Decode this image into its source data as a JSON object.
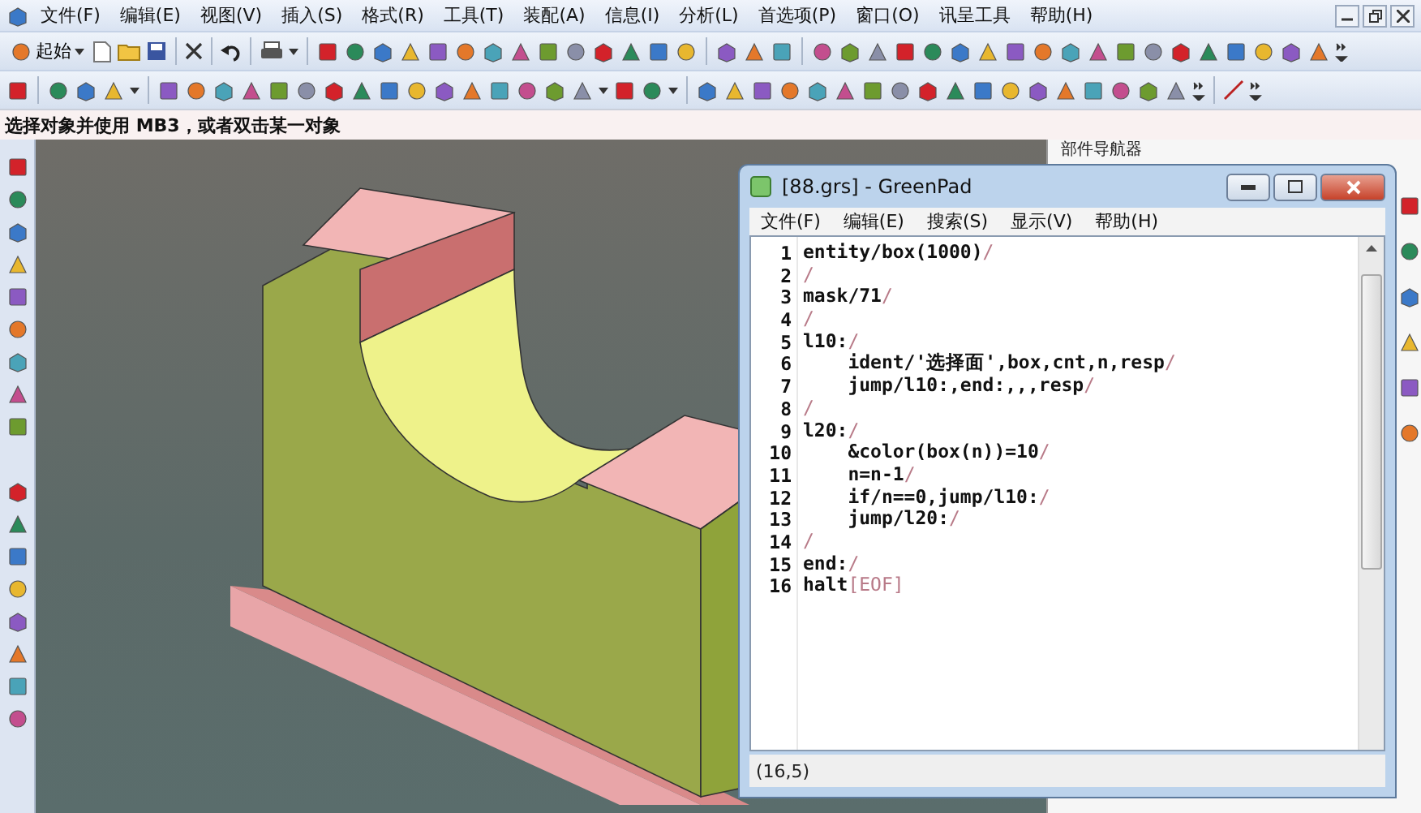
{
  "app_menu": [
    "文件(F)",
    "编辑(E)",
    "视图(V)",
    "插入(S)",
    "格式(R)",
    "工具(T)",
    "装配(A)",
    "信息(I)",
    "分析(L)",
    "首选项(P)",
    "窗口(O)",
    "讯呈工具",
    "帮助(H)"
  ],
  "start_button": {
    "label": "起始"
  },
  "hint": "选择对象并使用 MB3，或者双击某一对象",
  "navigator": {
    "title": "部件导航器"
  },
  "editor": {
    "title": "[88.grs] - GreenPad",
    "menu": [
      "文件(F)",
      "编辑(E)",
      "搜索(S)",
      "显示(V)",
      "帮助(H)"
    ],
    "eol_mark": "/",
    "eof_mark": "[EOF]",
    "lines": [
      {
        "number": "1",
        "text": "entity/box(1000)"
      },
      {
        "number": "2"
      },
      {
        "number": "3",
        "text": "mask/71"
      },
      {
        "number": "4"
      },
      {
        "number": "5",
        "text": "l10:"
      },
      {
        "number": "6",
        "text": "    ident/'选择面',box,cnt,n,resp"
      },
      {
        "number": "7",
        "text": "    jump/l10:,end:,,,resp"
      },
      {
        "number": "8"
      },
      {
        "number": "9",
        "text": "l20:"
      },
      {
        "number": "10",
        "text": "    &color(box(n))=10"
      },
      {
        "number": "11",
        "text": "    n=n-1"
      },
      {
        "number": "12",
        "text": "    if/n==0,jump/l10:"
      },
      {
        "number": "13",
        "text": "    jump/l20:"
      },
      {
        "number": "14"
      },
      {
        "number": "15",
        "text": "end:"
      },
      {
        "number": "16",
        "text": "halt"
      }
    ],
    "status": {
      "position": "(16,5)"
    }
  }
}
